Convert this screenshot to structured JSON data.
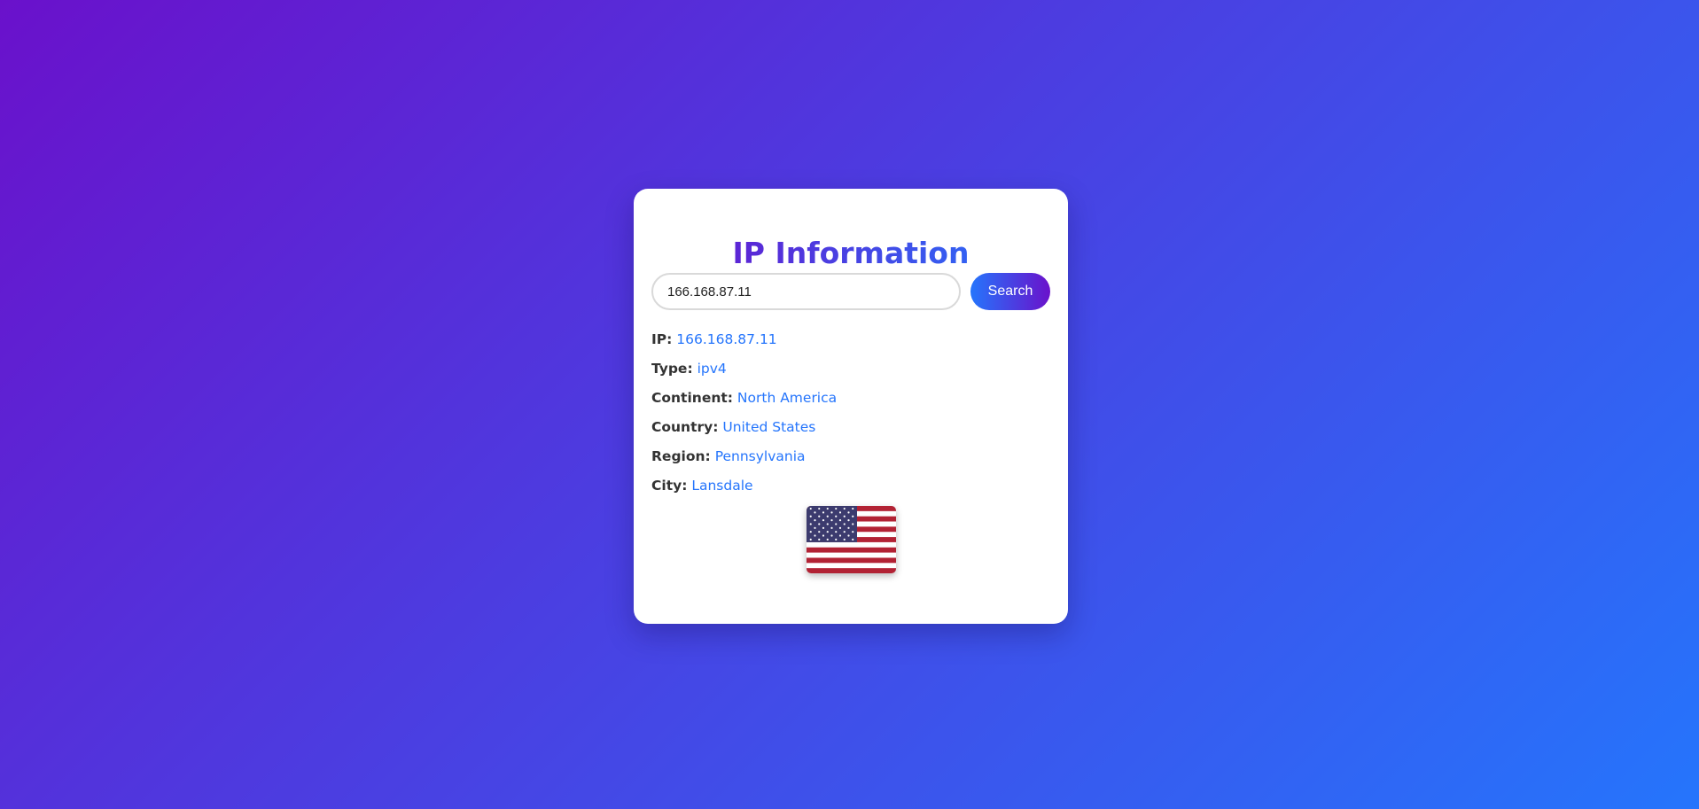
{
  "card": {
    "title": "IP Information",
    "search": {
      "value": "166.168.87.11",
      "button_label": "Search"
    },
    "fields": [
      {
        "label": "IP:",
        "value": "166.168.87.11"
      },
      {
        "label": "Type:",
        "value": "ipv4"
      },
      {
        "label": "Continent:",
        "value": "North America"
      },
      {
        "label": "Country:",
        "value": "United States"
      },
      {
        "label": "Region:",
        "value": "Pennsylvania"
      },
      {
        "label": "City:",
        "value": "Lansdale"
      }
    ],
    "flag_icon": "us-flag-icon"
  },
  "colors": {
    "gradient_start": "#6a11cb",
    "gradient_end": "#2575fc",
    "value_text": "#2575fc",
    "label_text": "#333333"
  }
}
